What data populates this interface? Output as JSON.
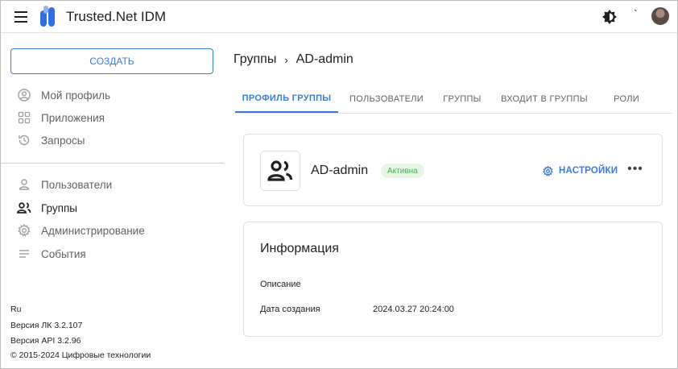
{
  "header": {
    "app_title": "Trusted.Net IDM",
    "tick_mark": "`"
  },
  "sidebar": {
    "create_label": "СОЗДАТЬ",
    "items": [
      {
        "label": "Мой профиль",
        "icon": "profile-icon"
      },
      {
        "label": "Приложения",
        "icon": "apps-icon"
      },
      {
        "label": "Запросы",
        "icon": "history-icon"
      },
      {
        "label": "Пользователи",
        "icon": "user-icon"
      },
      {
        "label": "Группы",
        "icon": "group-icon"
      },
      {
        "label": "Администрирование",
        "icon": "gear-icon"
      },
      {
        "label": "События",
        "icon": "events-icon"
      }
    ],
    "footer": {
      "lang": "Ru",
      "lk_version": "Версия ЛК 3.2.107",
      "api_version": "Версия API 3.2.96",
      "copyright": "© 2015-2024 Цифровые технологии"
    }
  },
  "breadcrumb": {
    "parent": "Группы",
    "separator": "›",
    "current": "AD-admin"
  },
  "tabs": [
    {
      "label": "ПРОФИЛЬ ГРУППЫ",
      "active": true
    },
    {
      "label": "ПОЛЬЗОВАТЕЛИ",
      "active": false
    },
    {
      "label": "ГРУППЫ",
      "active": false
    },
    {
      "label": "ВХОДИТ В ГРУППЫ",
      "active": false
    },
    {
      "label": "РОЛИ",
      "active": false
    }
  ],
  "group": {
    "name": "AD-admin",
    "status": "Активна",
    "settings_label": "НАСТРОЙКИ",
    "more_label": "•••"
  },
  "info": {
    "title": "Информация",
    "description_label": "Описание",
    "description_value": "",
    "created_label": "Дата создания",
    "created_value": "2024.03.27 20:24:00"
  },
  "colors": {
    "accent": "#3a7bd5",
    "status_green": "#4caf50",
    "status_bg": "#e5f5e6"
  }
}
